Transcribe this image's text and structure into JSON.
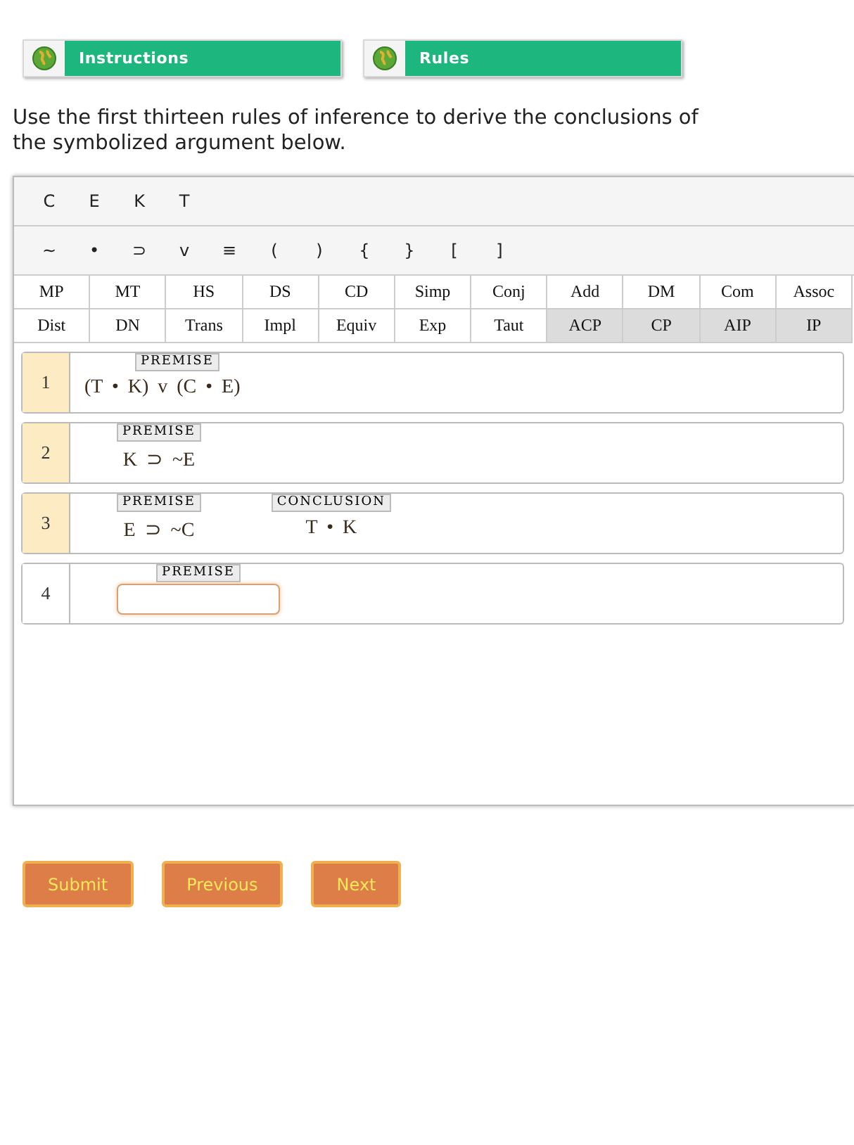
{
  "tabs": [
    {
      "label": "Instructions"
    },
    {
      "label": "Rules"
    }
  ],
  "instructions": "Use the first thirteen rules of inference to derive the conclusions of the symbolized argument below.",
  "letters": [
    "C",
    "E",
    "K",
    "T"
  ],
  "symbols": [
    "~",
    "•",
    "⊃",
    "v",
    "≡",
    "(",
    ")",
    "{",
    "}",
    "[",
    "]"
  ],
  "rules": [
    {
      "label": "MP",
      "shaded": false
    },
    {
      "label": "MT",
      "shaded": false
    },
    {
      "label": "HS",
      "shaded": false
    },
    {
      "label": "DS",
      "shaded": false
    },
    {
      "label": "CD",
      "shaded": false
    },
    {
      "label": "Simp",
      "shaded": false
    },
    {
      "label": "Conj",
      "shaded": false
    },
    {
      "label": "Add",
      "shaded": false
    },
    {
      "label": "DM",
      "shaded": false
    },
    {
      "label": "Com",
      "shaded": false
    },
    {
      "label": "Assoc",
      "shaded": false
    },
    {
      "label": "Dist",
      "shaded": false
    },
    {
      "label": "DN",
      "shaded": false
    },
    {
      "label": "Trans",
      "shaded": false
    },
    {
      "label": "Impl",
      "shaded": false
    },
    {
      "label": "Equiv",
      "shaded": false
    },
    {
      "label": "Exp",
      "shaded": false
    },
    {
      "label": "Taut",
      "shaded": false
    },
    {
      "label": "ACP",
      "shaded": true
    },
    {
      "label": "CP",
      "shaded": true
    },
    {
      "label": "AIP",
      "shaded": true
    },
    {
      "label": "IP",
      "shaded": true
    }
  ],
  "lines": [
    {
      "number": "1",
      "kind": "given",
      "tag": "PREMISE",
      "formula": "(T • K) v (C • E)"
    },
    {
      "number": "2",
      "kind": "given",
      "tag": "PREMISE",
      "formula": "K ⊃ ~E"
    },
    {
      "number": "3",
      "kind": "given",
      "tag": "PREMISE",
      "formula": "E ⊃ ~C",
      "conclusion_tag": "CONCLUSION",
      "conclusion": "T • K"
    },
    {
      "number": "4",
      "kind": "input",
      "tag": "PREMISE"
    }
  ],
  "buttons": [
    "Submit",
    "Previous",
    "Next"
  ]
}
